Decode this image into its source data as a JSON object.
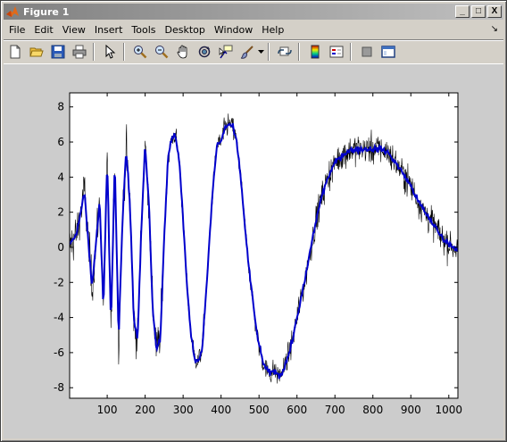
{
  "window": {
    "title": "Figure 1",
    "buttons": {
      "minimize": "_",
      "maximize": "□",
      "close": "X"
    }
  },
  "menu": {
    "items": [
      "File",
      "Edit",
      "View",
      "Insert",
      "Tools",
      "Desktop",
      "Window",
      "Help"
    ],
    "dock_arrow": "↘"
  },
  "toolbar": {
    "icons": [
      "new-figure-icon",
      "open-file-icon",
      "save-icon",
      "print-icon",
      "edit-plot-icon",
      "zoom-in-icon",
      "zoom-out-icon",
      "pan-icon",
      "rotate-3d-icon",
      "data-cursor-icon",
      "brush-icon",
      "link-plot-icon",
      "colorbar-icon",
      "legend-icon",
      "hide-plot-tools-icon",
      "show-plot-tools-icon"
    ]
  },
  "chart_data": {
    "type": "line",
    "title": "",
    "xlabel": "",
    "ylabel": "",
    "xlim": [
      1,
      1024
    ],
    "ylim": [
      -8.6,
      8.8
    ],
    "xticks": [
      100,
      200,
      300,
      400,
      500,
      600,
      700,
      800,
      900,
      1000
    ],
    "yticks": [
      8,
      6,
      4,
      2,
      0,
      -2,
      -4,
      -6,
      -8
    ],
    "grid": false,
    "legend": "none",
    "series": [
      {
        "description_key": "noisy",
        "color": "#000000",
        "x": [
          1,
          20,
          40,
          60,
          80,
          90,
          100,
          110,
          120,
          130,
          140,
          150,
          160,
          170,
          180,
          190,
          200,
          210,
          220,
          230,
          240,
          250,
          260,
          270,
          280,
          290,
          300,
          310,
          320,
          330,
          340,
          350,
          360,
          370,
          380,
          390,
          400,
          410,
          420,
          430,
          440,
          450,
          460,
          470,
          480,
          490,
          500,
          510,
          520,
          530,
          540,
          550,
          560,
          570,
          580,
          590,
          600,
          620,
          640,
          660,
          680,
          700,
          720,
          740,
          760,
          780,
          800,
          820,
          840,
          860,
          880,
          900,
          920,
          940,
          960,
          980,
          1000,
          1024
        ],
        "y": [
          0.1,
          0.8,
          3.2,
          -2.3,
          2.6,
          -3.5,
          5.0,
          -4.5,
          5.0,
          -5.2,
          1.5,
          5.6,
          2.5,
          -4.0,
          -5.3,
          1.0,
          5.9,
          2.5,
          -3.5,
          -5.8,
          -5.2,
          0.6,
          5.0,
          6.2,
          6.4,
          4.9,
          1.6,
          -2.2,
          -4.8,
          -6.3,
          -6.5,
          -5.8,
          -2.8,
          0.6,
          3.8,
          5.9,
          6.0,
          6.8,
          7.0,
          6.9,
          6.1,
          4.4,
          1.9,
          -0.5,
          -2.4,
          -4.2,
          -5.6,
          -6.5,
          -7.0,
          -7.2,
          -7.0,
          -7.3,
          -7.2,
          -6.6,
          -6.0,
          -5.1,
          -4.0,
          -2.0,
          0.4,
          2.5,
          3.9,
          4.8,
          5.3,
          5.5,
          5.6,
          5.6,
          5.6,
          5.6,
          5.4,
          4.8,
          4.2,
          3.5,
          2.6,
          1.9,
          1.3,
          0.6,
          0.2,
          -0.1
        ]
      },
      {
        "description_key": "smoothed",
        "color": "#0000cc",
        "x": [
          1,
          20,
          40,
          60,
          80,
          90,
          100,
          110,
          120,
          130,
          140,
          150,
          160,
          170,
          180,
          190,
          200,
          210,
          220,
          230,
          240,
          250,
          260,
          270,
          280,
          290,
          300,
          310,
          320,
          330,
          340,
          350,
          360,
          370,
          380,
          390,
          400,
          410,
          420,
          430,
          440,
          450,
          460,
          470,
          480,
          490,
          500,
          510,
          520,
          530,
          540,
          550,
          560,
          570,
          580,
          590,
          600,
          620,
          640,
          660,
          680,
          700,
          720,
          740,
          760,
          780,
          800,
          820,
          840,
          860,
          880,
          900,
          920,
          940,
          960,
          980,
          1000,
          1024
        ],
        "y": [
          0.1,
          0.8,
          3.2,
          -2.3,
          2.6,
          -3.5,
          5.0,
          -4.5,
          5.0,
          -5.2,
          1.5,
          5.6,
          2.5,
          -4.0,
          -5.3,
          1.0,
          5.9,
          2.5,
          -3.5,
          -5.8,
          -5.2,
          0.6,
          5.0,
          6.2,
          6.4,
          4.9,
          1.6,
          -2.2,
          -4.8,
          -6.3,
          -6.5,
          -5.8,
          -2.8,
          0.6,
          3.8,
          5.9,
          6.0,
          6.8,
          7.0,
          6.9,
          6.1,
          4.4,
          1.9,
          -0.5,
          -2.4,
          -4.2,
          -5.6,
          -6.5,
          -7.0,
          -7.2,
          -7.0,
          -7.3,
          -7.2,
          -6.6,
          -6.0,
          -5.1,
          -4.0,
          -2.0,
          0.4,
          2.5,
          3.9,
          4.8,
          5.3,
          5.5,
          5.6,
          5.6,
          5.6,
          5.6,
          5.4,
          4.8,
          4.2,
          3.5,
          2.6,
          1.9,
          1.3,
          0.6,
          0.2,
          -0.1
        ]
      }
    ]
  }
}
